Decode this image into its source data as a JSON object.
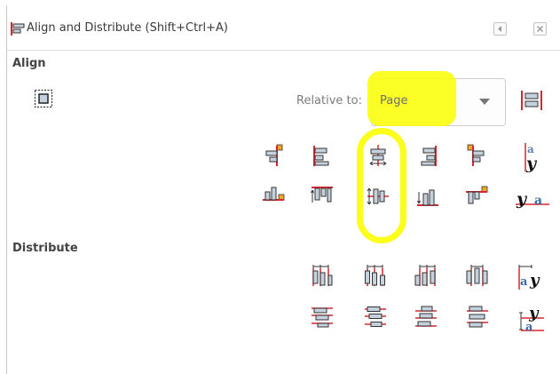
{
  "dialog": {
    "title": "Align and Distribute (Shift+Ctrl+A)",
    "icon": "align-distribute-icon",
    "window_buttons": [
      "collapse-icon",
      "close-icon"
    ]
  },
  "align": {
    "section_label": "Align",
    "relative_to_label": "Relative to:",
    "relative_to_value": "Page",
    "row1_buttons": [
      "align-right-edges-to-left-anchor-icon",
      "align-left-edges-icon",
      "center-on-vertical-axis-icon",
      "align-right-sides-icon",
      "align-left-edges-to-right-anchor-icon",
      "align-baseline-vertically-icon"
    ],
    "row2_buttons": [
      "align-bottom-edges-to-top-anchor-icon",
      "align-top-edges-icon",
      "center-on-horizontal-axis-icon",
      "align-bottom-edges-icon",
      "align-top-edges-to-bottom-anchor-icon",
      "align-baseline-horizontally-icon"
    ],
    "baseline_letters": {
      "a": "a",
      "y": "y"
    }
  },
  "distribute": {
    "section_label": "Distribute",
    "row1_buttons": [
      "distribute-left-edges-icon",
      "distribute-centers-horizontally-icon",
      "distribute-right-edges-icon",
      "distribute-gaps-horizontally-icon",
      "distribute-baselines-horizontally-icon"
    ],
    "row2_buttons": [
      "distribute-top-edges-icon",
      "distribute-centers-vertically-icon",
      "distribute-bottom-edges-icon",
      "distribute-gaps-vertically-icon",
      "distribute-baselines-vertically-icon"
    ]
  },
  "colors": {
    "highlight": "#fbff00",
    "guide_red": "#d9262e",
    "box_fill": "#c5d1dc",
    "anchor_orange": "#f5a623"
  }
}
